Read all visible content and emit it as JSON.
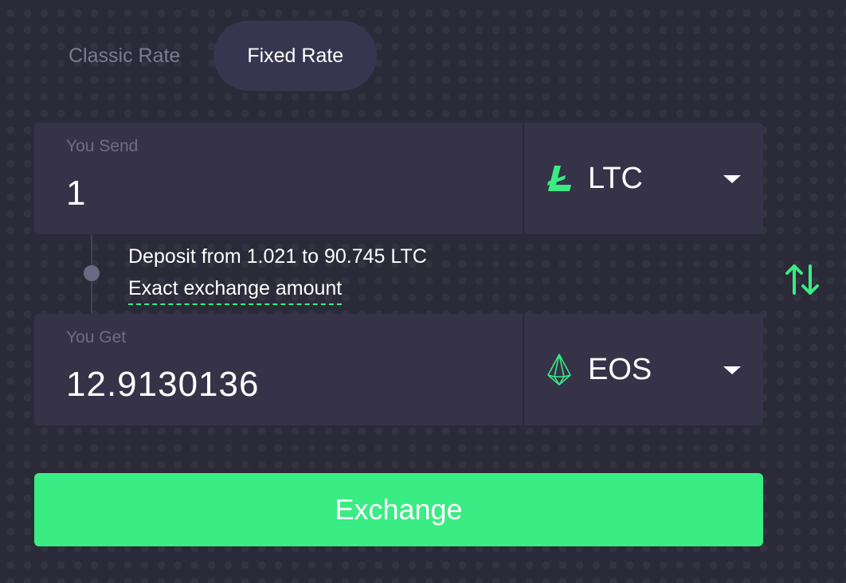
{
  "tabs": {
    "classic": "Classic Rate",
    "fixed": "Fixed Rate"
  },
  "send": {
    "label": "You Send",
    "amount": "1",
    "coin": "LTC",
    "icon": "litecoin-icon"
  },
  "get": {
    "label": "You Get",
    "amount": "12.9130136",
    "coin": "EOS",
    "icon": "eos-icon"
  },
  "info": {
    "deposit_range": "Deposit from 1.021 to 90.745 LTC",
    "exact_link": "Exact exchange amount"
  },
  "actions": {
    "exchange": "Exchange",
    "swap_icon": "swap-arrows-icon"
  },
  "colors": {
    "accent": "#39ec83",
    "background": "#2b2a38",
    "panel": "#363248"
  }
}
